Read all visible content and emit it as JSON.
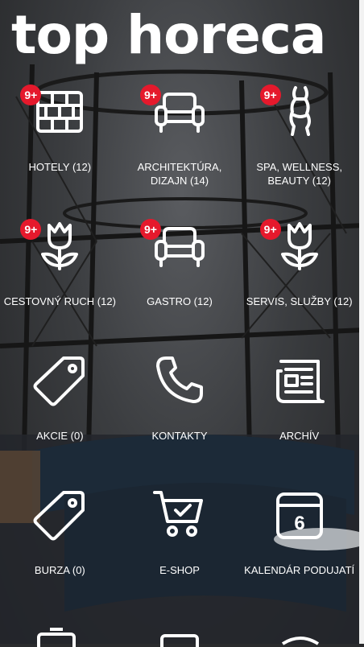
{
  "app": {
    "logo_text": "top horeca"
  },
  "tiles": [
    {
      "label": "HOTELY (12)",
      "icon": "brick-wall-icon",
      "badge": "9+"
    },
    {
      "label": "ARCHITEKTÚRA, DIZAJN (14)",
      "icon": "armchair-icon",
      "badge": "9+"
    },
    {
      "label": "SPA, WELLNESS, BEAUTY (12)",
      "icon": "body-silhouette-icon",
      "badge": "9+"
    },
    {
      "label": "CESTOVNÝ RUCH (12)",
      "icon": "tulip-icon",
      "badge": "9+"
    },
    {
      "label": "GASTRO (12)",
      "icon": "armchair-icon",
      "badge": "9+"
    },
    {
      "label": "SERVIS, SLUŽBY (12)",
      "icon": "tulip-icon",
      "badge": "9+"
    },
    {
      "label": "AKCIE (0)",
      "icon": "price-tag-icon"
    },
    {
      "label": "KONTAKTY",
      "icon": "phone-icon"
    },
    {
      "label": "ARCHÍV",
      "icon": "newspaper-icon"
    },
    {
      "label": "BURZA (0)",
      "icon": "price-tag-icon"
    },
    {
      "label": "E-SHOP",
      "icon": "shopping-cart-icon"
    },
    {
      "label": "KALENDÁR PODUJATÍ",
      "icon": "calendar-icon",
      "day": "6"
    }
  ],
  "colors": {
    "badge": "#e5192c",
    "icon": "#ffffff",
    "label": "#ffffff"
  }
}
